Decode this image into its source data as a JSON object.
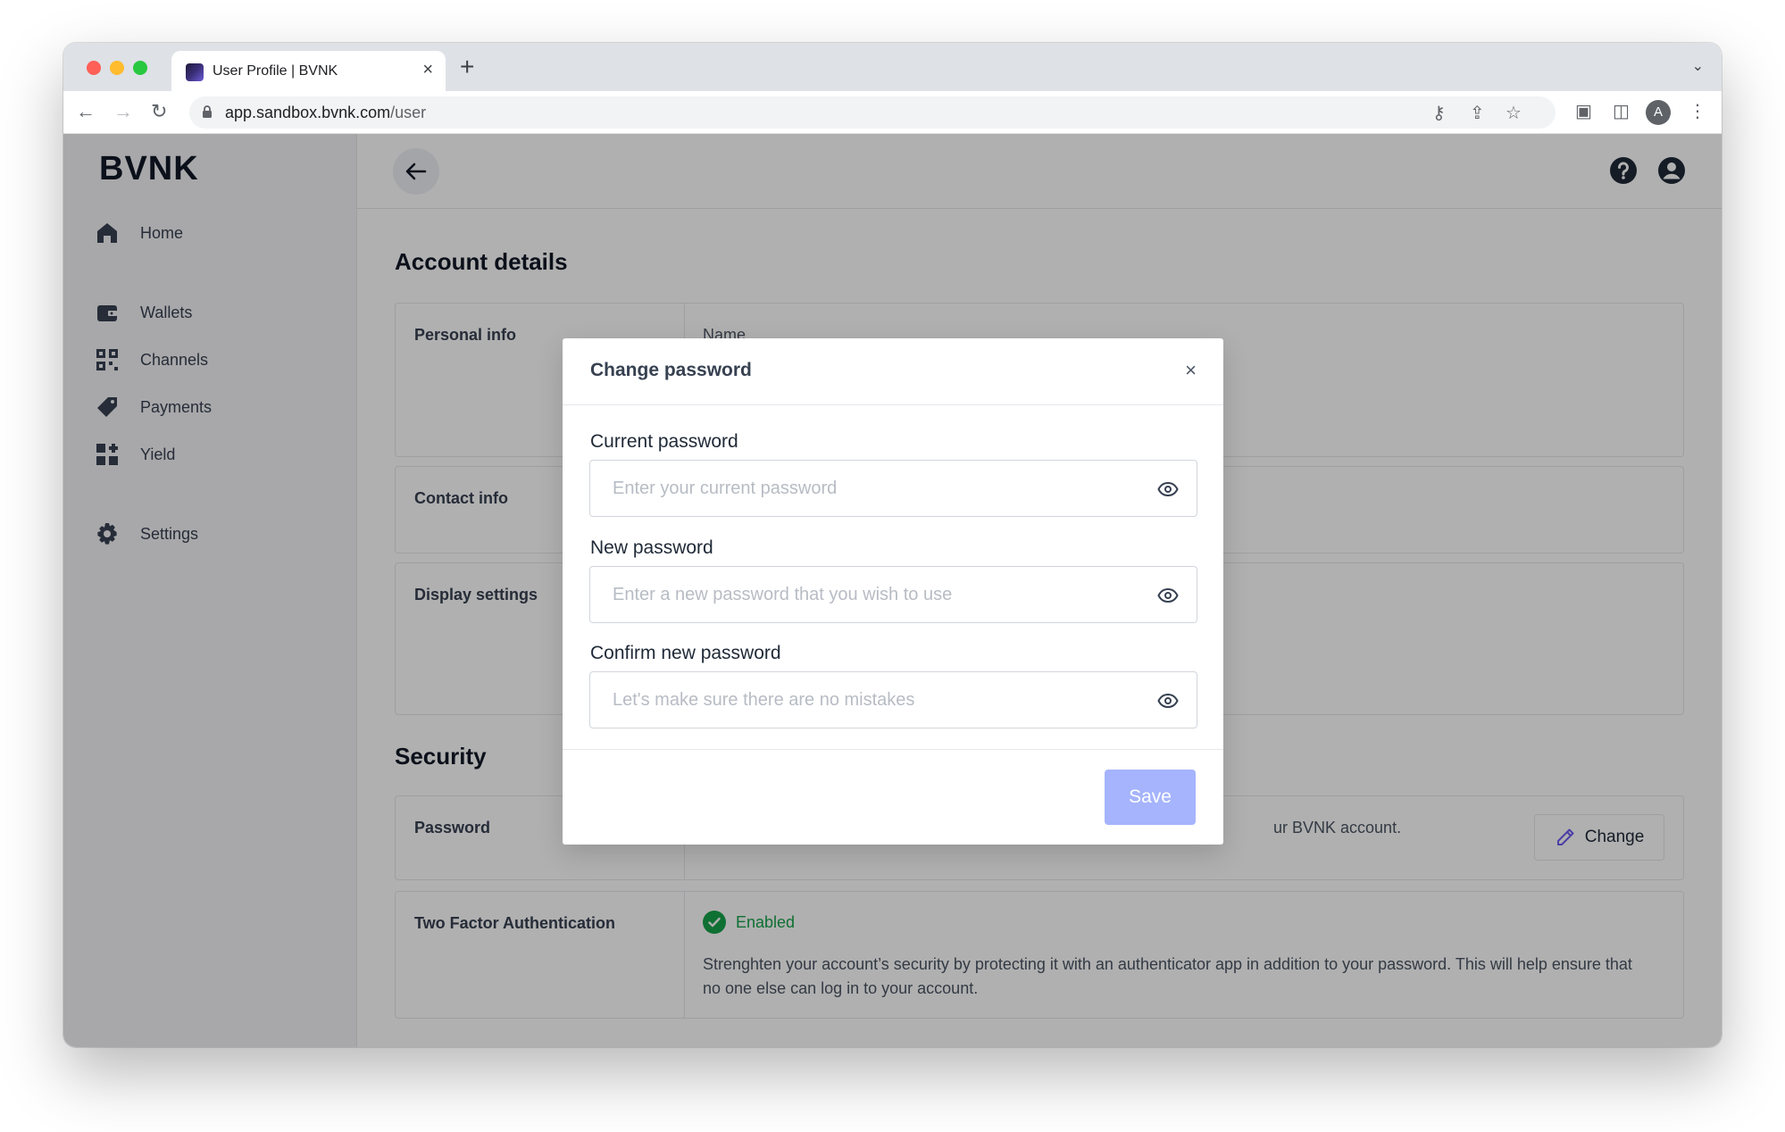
{
  "browser": {
    "tab_title": "User Profile | BVNK",
    "tab_close": "×",
    "new_tab": "+",
    "url_host": "app.sandbox.bvnk.com",
    "url_path": "/user",
    "profile_initial": "A"
  },
  "sidebar": {
    "logo": "BVNK",
    "items": [
      {
        "label": "Home",
        "icon": "home-icon"
      },
      {
        "label": "Wallets",
        "icon": "wallet-icon"
      },
      {
        "label": "Channels",
        "icon": "qr-icon"
      },
      {
        "label": "Payments",
        "icon": "tag-icon"
      },
      {
        "label": "Yield",
        "icon": "grid-icon"
      },
      {
        "label": "Settings",
        "icon": "gear-icon"
      }
    ]
  },
  "main": {
    "account_title": "Account details",
    "personal_info_label": "Personal info",
    "name_label": "Name",
    "contact_info_label": "Contact info",
    "display_settings_label": "Display settings",
    "security_title": "Security",
    "password_label": "Password",
    "password_desc_fragment": "ur BVNK account.",
    "change_button": "Change",
    "twofa_label": "Two Factor Authentication",
    "twofa_status": "Enabled",
    "twofa_desc": "Strenghten your account’s security by protecting it with an authenticator app in addition to your password. This will help ensure that no one else can log in to your account."
  },
  "modal": {
    "title": "Change password",
    "close": "×",
    "current_label": "Current password",
    "current_placeholder": "Enter your current password",
    "new_label": "New password",
    "new_placeholder": "Enter a new password that you wish to use",
    "confirm_label": "Confirm new password",
    "confirm_placeholder": "Let's make sure there are no mistakes",
    "save_button": "Save"
  },
  "colors": {
    "accent_disabled": "#a5b4fc",
    "success": "#16a34a",
    "overlay": "rgba(0,0,0,0.31)"
  }
}
